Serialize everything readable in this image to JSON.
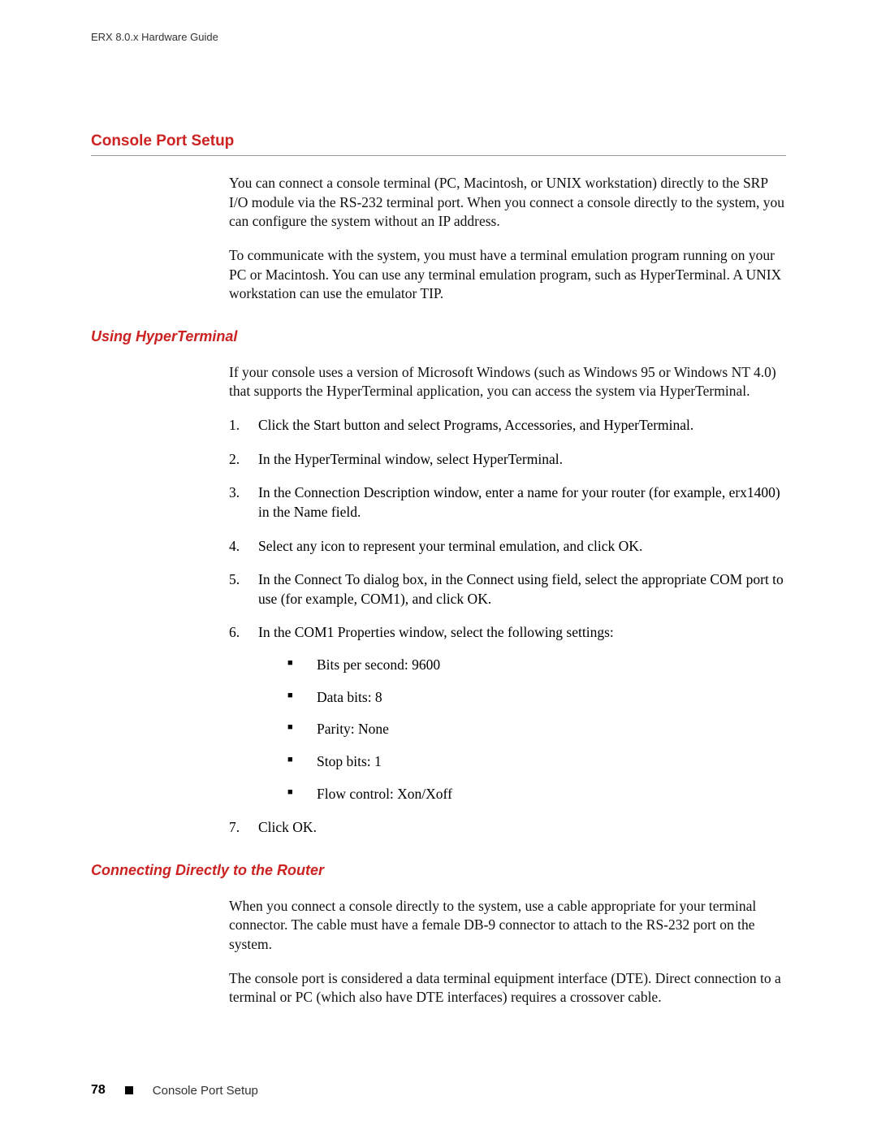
{
  "header": "ERX 8.0.x Hardware Guide",
  "section_title": "Console Port Setup",
  "intro_p1": "You can connect a console terminal (PC, Macintosh, or UNIX workstation) directly to the SRP I/O module via the RS-232 terminal port. When you connect a console directly to the system, you can configure the system without an IP address.",
  "intro_p2": "To communicate with the system, you must have a terminal emulation program running on your PC or Macintosh. You can use any terminal emulation program, such as HyperTerminal. A UNIX workstation can use the emulator TIP.",
  "sub1_title": "Using HyperTerminal",
  "sub1_intro": "If your console uses a version of Microsoft Windows (such as Windows 95 or Windows NT 4.0) that supports the HyperTerminal application, you can access the system via HyperTerminal.",
  "steps": [
    "Click the Start button and select Programs, Accessories, and HyperTerminal.",
    "In the HyperTerminal window, select HyperTerminal.",
    "In the Connection Description window, enter a name for your router (for example, erx1400) in the Name field.",
    "Select any icon to represent your terminal emulation, and click OK.",
    "In the Connect To dialog box, in the Connect using field, select the appropriate COM port to use (for example, COM1), and click OK.",
    "In the COM1 Properties window, select the following settings:",
    "Click OK."
  ],
  "settings": [
    "Bits per second: 9600",
    "Data bits: 8",
    "Parity: None",
    "Stop bits: 1",
    "Flow control: Xon/Xoff"
  ],
  "sub2_title": "Connecting Directly to the Router",
  "sub2_p1": "When you connect a console directly to the system, use a cable appropriate for your terminal connector. The cable must have a female DB-9 connector to attach to the RS-232 port on the system.",
  "sub2_p2": "The console port is considered a data terminal equipment interface (DTE). Direct connection to a terminal or PC (which also have DTE interfaces) requires a crossover cable.",
  "footer": {
    "page_number": "78",
    "section_label": "Console Port Setup"
  }
}
